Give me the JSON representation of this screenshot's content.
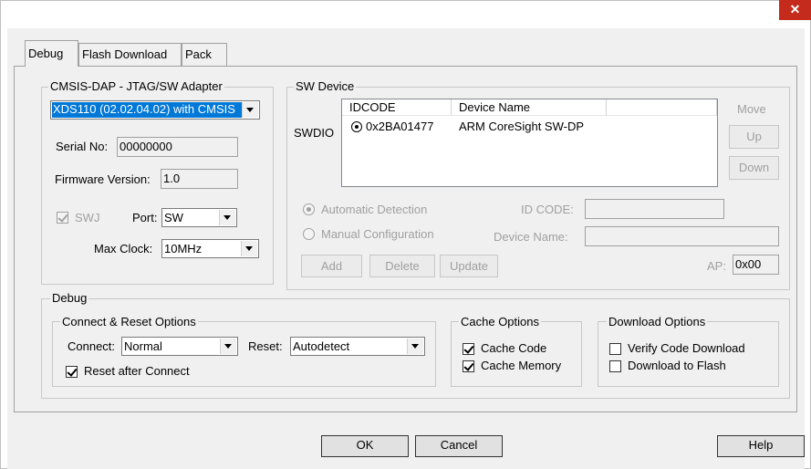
{
  "window": {
    "close_glyph": "✕"
  },
  "tabs": [
    {
      "label": "Debug",
      "selected": true
    },
    {
      "label": "Flash Download",
      "selected": false
    },
    {
      "label": "Pack",
      "selected": false
    }
  ],
  "adapter": {
    "title": "CMSIS-DAP - JTAG/SW Adapter",
    "device_value": "XDS110 (02.02.04.02) with CMSIS",
    "serial_label": "Serial No:",
    "serial_value": "00000000",
    "firmware_label": "Firmware Version:",
    "firmware_value": "1.0",
    "swj_label": "SWJ",
    "swj_checked": true,
    "port_label": "Port:",
    "port_value": "SW",
    "max_clock_label": "Max Clock:",
    "max_clock_value": "10MHz"
  },
  "sw_device": {
    "title": "SW Device",
    "columns": [
      "IDCODE",
      "Device Name",
      ""
    ],
    "row_label": "SWDIO",
    "rows": [
      {
        "idcode": "0x2BA01477",
        "device_name": "ARM CoreSight SW-DP"
      }
    ],
    "move_label": "Move",
    "up_label": "Up",
    "down_label": "Down",
    "auto_detect_label": "Automatic Detection",
    "manual_config_label": "Manual Configuration",
    "id_code_label": "ID CODE:",
    "id_code_value": "",
    "device_name_label": "Device Name:",
    "device_name_value": "",
    "add_label": "Add",
    "delete_label": "Delete",
    "update_label": "Update",
    "ap_label": "AP:",
    "ap_value": "0x00"
  },
  "debug": {
    "title": "Debug",
    "connect_reset": {
      "title": "Connect & Reset Options",
      "connect_label": "Connect:",
      "connect_value": "Normal",
      "reset_label": "Reset:",
      "reset_value": "Autodetect",
      "reset_after_connect_label": "Reset after Connect",
      "reset_after_connect_checked": true
    },
    "cache": {
      "title": "Cache Options",
      "cache_code_label": "Cache Code",
      "cache_code_checked": true,
      "cache_memory_label": "Cache Memory",
      "cache_memory_checked": true
    },
    "download": {
      "title": "Download Options",
      "verify_label": "Verify Code Download",
      "verify_checked": false,
      "flash_label": "Download to Flash",
      "flash_checked": false
    }
  },
  "buttons": {
    "ok": "OK",
    "cancel": "Cancel",
    "help": "Help"
  },
  "colors": {
    "selection": "#0078d7",
    "close_button": "#c42b1c"
  }
}
